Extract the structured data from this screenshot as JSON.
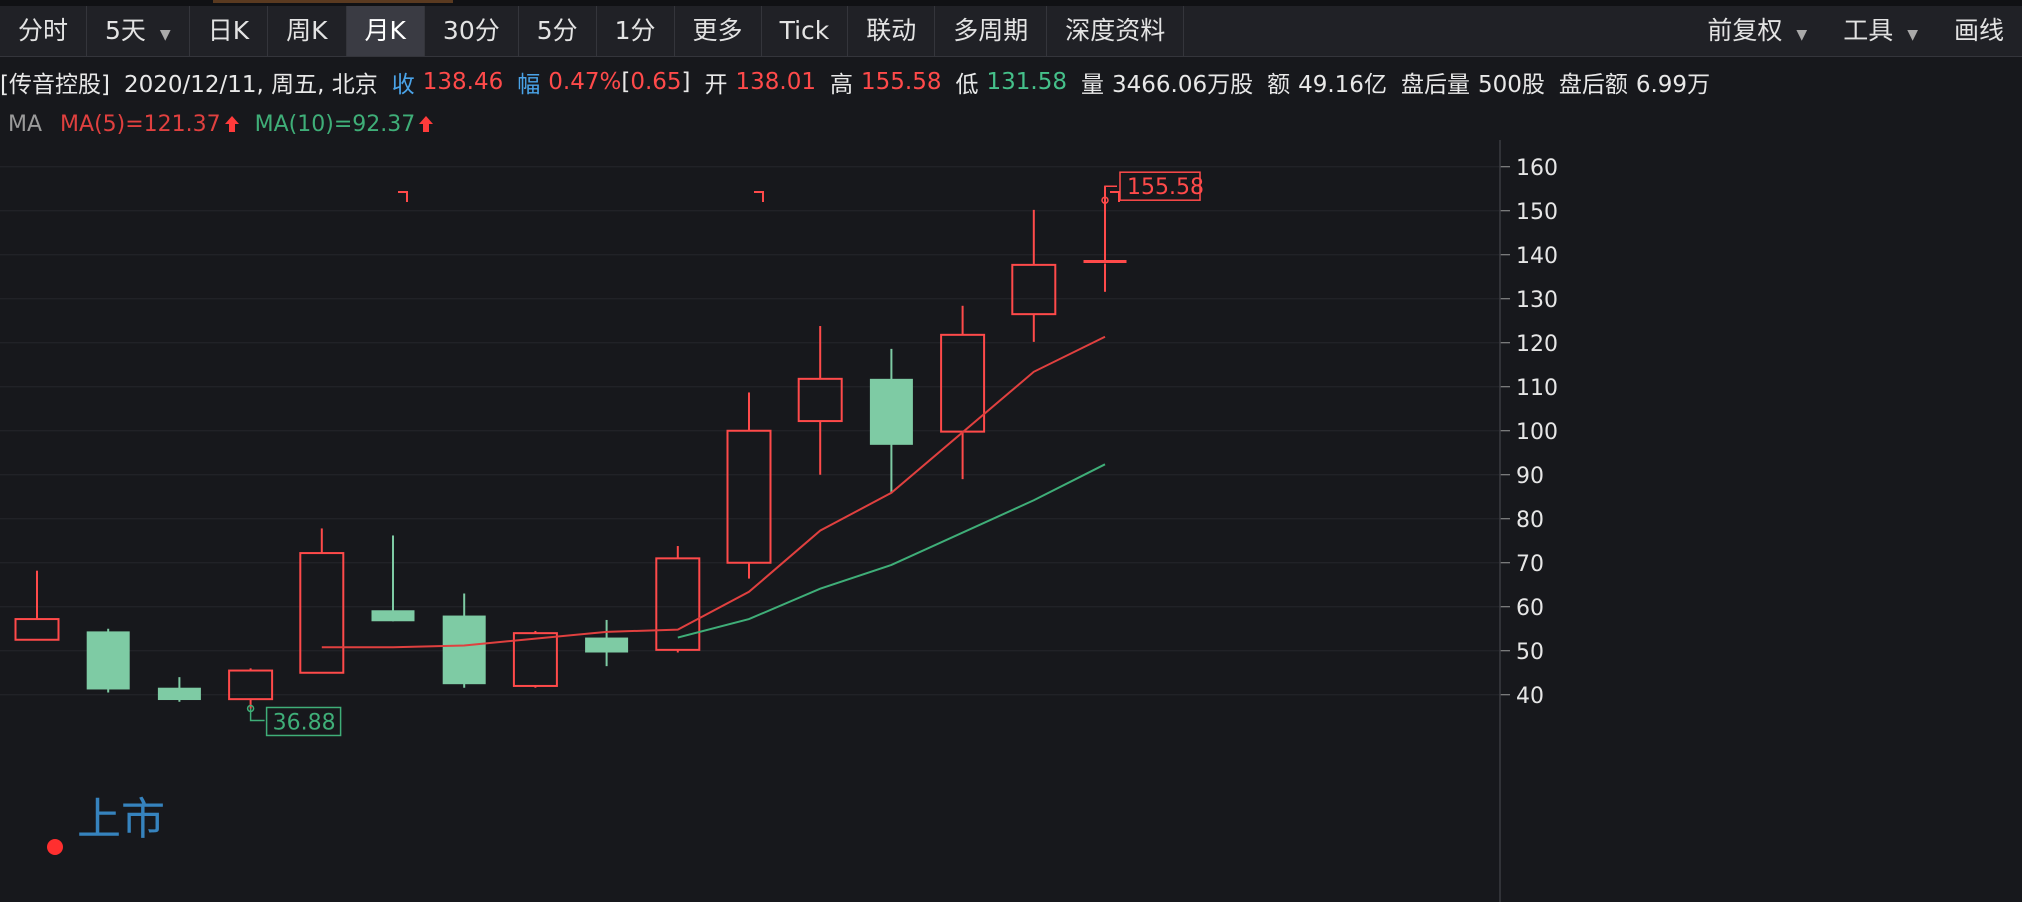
{
  "tabs": [
    {
      "label": "分时",
      "active": false,
      "dropdown": false
    },
    {
      "label": "5天",
      "active": false,
      "dropdown": true
    },
    {
      "label": "日K",
      "active": false,
      "dropdown": false
    },
    {
      "label": "周K",
      "active": false,
      "dropdown": false
    },
    {
      "label": "月K",
      "active": true,
      "dropdown": false
    },
    {
      "label": "30分",
      "active": false,
      "dropdown": false
    },
    {
      "label": "5分",
      "active": false,
      "dropdown": false
    },
    {
      "label": "1分",
      "active": false,
      "dropdown": false
    },
    {
      "label": "更多",
      "active": false,
      "dropdown": false
    },
    {
      "label": "Tick",
      "active": false,
      "dropdown": false
    },
    {
      "label": "联动",
      "active": false,
      "dropdown": false
    },
    {
      "label": "多周期",
      "active": false,
      "dropdown": false
    },
    {
      "label": "深度资料",
      "active": false,
      "dropdown": false
    }
  ],
  "right_tabs": [
    {
      "label": "前复权",
      "dropdown": true
    },
    {
      "label": "工具",
      "dropdown": true
    },
    {
      "label": "画线",
      "dropdown": false
    }
  ],
  "info": {
    "name": "[传音控股]",
    "date": "2020/12/11, 周五, 北京",
    "close_label": "收",
    "close": "138.46",
    "amp_label": "幅",
    "amp": "0.47%",
    "amp_bracket_open": "[",
    "amp_abs": "0.65",
    "amp_bracket_close": "]",
    "open_label": "开",
    "open": "138.01",
    "high_label": "高",
    "high": "155.58",
    "low_label": "低",
    "low": "131.58",
    "vol_label": "量",
    "vol": "3466.06万股",
    "amt_label": "额",
    "amt": "49.16亿",
    "after_vol_label": "盘后量",
    "after_vol": "500股",
    "after_amt_label": "盘后额",
    "after_amt": "6.99万"
  },
  "ma": {
    "label": "MA",
    "ma5": "MA(5)=121.37",
    "ma10": "MA(10)=92.37",
    "arrow_icon": "up-arrow-icon"
  },
  "colors": {
    "up": "#ff4a4a",
    "down": "#7ecba4",
    "ma5": "#e0403f",
    "ma10": "#3fae78",
    "listing": "#3a8fd0"
  },
  "chart_data": {
    "type": "candlestick",
    "period": "monthly",
    "ylim": [
      35,
      165
    ],
    "y_ticks": [
      40,
      50,
      60,
      70,
      80,
      90,
      100,
      110,
      120,
      130,
      140,
      150,
      160
    ],
    "candles": [
      {
        "open": 52.5,
        "close": 57.2,
        "high": 68.2,
        "low": 52.5
      },
      {
        "open": 54.4,
        "close": 41.2,
        "high": 55.0,
        "low": 40.5
      },
      {
        "open": 41.6,
        "close": 38.8,
        "high": 44.0,
        "low": 38.4
      },
      {
        "open": 39.0,
        "close": 45.5,
        "high": 46.0,
        "low": 36.88
      },
      {
        "open": 45.0,
        "close": 72.2,
        "high": 77.8,
        "low": 45.0
      },
      {
        "open": 59.2,
        "close": 56.7,
        "high": 76.2,
        "low": 56.7
      },
      {
        "open": 58.0,
        "close": 42.4,
        "high": 63.0,
        "low": 41.6
      },
      {
        "open": 42.0,
        "close": 54.0,
        "high": 54.5,
        "low": 41.6
      },
      {
        "open": 53.0,
        "close": 49.6,
        "high": 57.0,
        "low": 46.5
      },
      {
        "open": 50.2,
        "close": 71.0,
        "high": 73.8,
        "low": 49.6
      },
      {
        "open": 70.0,
        "close": 100.0,
        "high": 108.7,
        "low": 66.4
      },
      {
        "open": 102.2,
        "close": 111.8,
        "high": 123.8,
        "low": 90.0
      },
      {
        "open": 111.8,
        "close": 96.8,
        "high": 118.6,
        "low": 85.8
      },
      {
        "open": 99.8,
        "close": 121.8,
        "high": 128.4,
        "low": 89.0
      },
      {
        "open": 126.5,
        "close": 137.7,
        "high": 150.2,
        "low": 120.2
      },
      {
        "open": 138.01,
        "close": 138.46,
        "high": 155.58,
        "low": 131.58
      }
    ],
    "ma5": [
      null,
      null,
      null,
      null,
      50.8,
      50.8,
      51.2,
      null,
      54.3,
      54.8,
      63.4,
      77.3,
      85.9,
      null,
      113.4,
      121.37
    ],
    "ma10": [
      null,
      null,
      null,
      null,
      null,
      null,
      null,
      null,
      null,
      53.0,
      57.2,
      64.1,
      69.5,
      null,
      84.2,
      92.37
    ],
    "annotations": [
      {
        "label": "155.58",
        "type": "high_marker",
        "candle": 15
      },
      {
        "label": "36.88",
        "type": "low_marker",
        "candle": 3
      },
      {
        "label": "上市",
        "type": "listing",
        "candle": 1
      }
    ],
    "period_markers": [
      5,
      10,
      15
    ]
  }
}
